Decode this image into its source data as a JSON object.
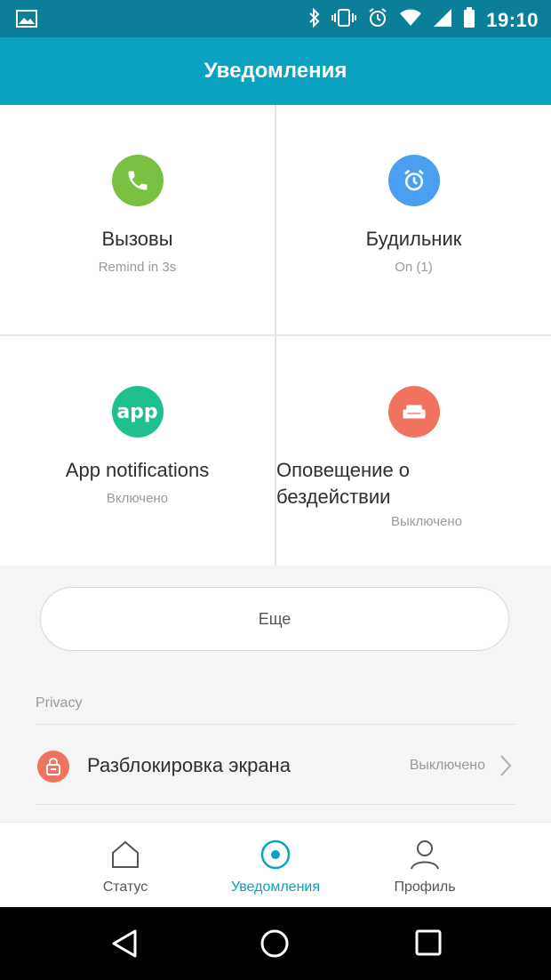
{
  "status_bar": {
    "time": "19:10",
    "icons": [
      "gallery-icon",
      "bluetooth-icon",
      "vibrate-icon",
      "alarm-icon",
      "wifi-icon",
      "signal-icon",
      "battery-icon"
    ]
  },
  "app_bar": {
    "title": "Уведомления"
  },
  "tiles": [
    {
      "name": "Вызовы",
      "status": "Remind in 3s",
      "icon": "phone-icon",
      "color": "#7ac142"
    },
    {
      "name": "Будильник",
      "status": "On (1)",
      "icon": "alarm-clock-icon",
      "color": "#4a9ff0"
    },
    {
      "name": "App notifications",
      "status": "Включено",
      "icon": "app-icon",
      "icon_text": "app",
      "color": "#1fbf8f"
    },
    {
      "name": "Оповещение о бездействии",
      "status": "Выключено",
      "icon": "sofa-icon",
      "color": "#f0735f"
    }
  ],
  "more_button": {
    "label": "Еще"
  },
  "privacy": {
    "header": "Privacy",
    "item": {
      "label": "Разблокировка экрана",
      "value": "Выключено",
      "icon": "lock-icon",
      "color": "#f0735f"
    }
  },
  "bottom_nav": {
    "items": [
      {
        "label": "Статус",
        "icon": "home-icon",
        "active": false
      },
      {
        "label": "Уведомления",
        "icon": "notifications-icon",
        "active": true
      },
      {
        "label": "Профиль",
        "icon": "profile-icon",
        "active": false
      }
    ],
    "active_color": "#0aa2c0"
  },
  "system_nav": [
    "back-icon",
    "home-circle-icon",
    "recents-icon"
  ]
}
